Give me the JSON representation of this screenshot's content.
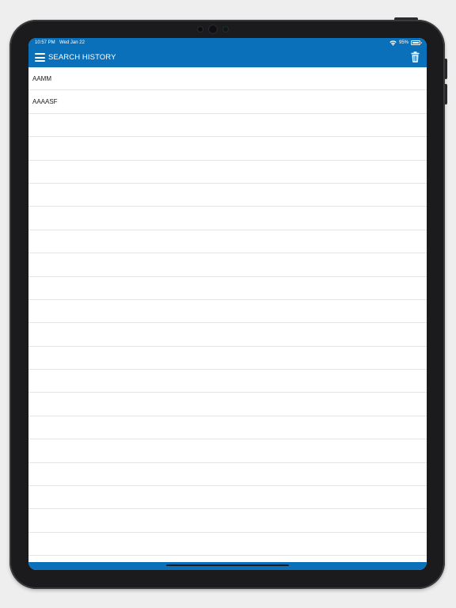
{
  "status_bar": {
    "time": "10:57 PM",
    "date": "Wed Jan 22",
    "battery": "95%",
    "icons": [
      "wifi-icon",
      "battery-icon"
    ]
  },
  "header": {
    "title": "SEARCH HISTORY",
    "menu_icon": "hamburger-menu-icon",
    "delete_icon": "trash-icon",
    "color": "#0a70b9"
  },
  "history": {
    "items": [
      "AAMM",
      "AAAASF",
      "",
      "",
      "",
      "",
      "",
      "",
      "",
      "",
      "",
      "",
      "",
      "",
      "",
      "",
      "",
      "",
      "",
      "",
      "",
      ""
    ]
  }
}
